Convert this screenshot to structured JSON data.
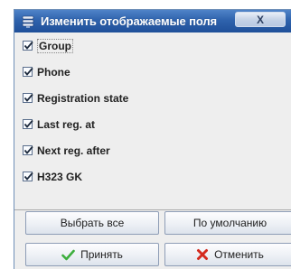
{
  "dialog": {
    "title": "Изменить отображаемые поля",
    "close_glyph": "X"
  },
  "fields": [
    {
      "label": "Group",
      "checked": true
    },
    {
      "label": "Phone",
      "checked": true
    },
    {
      "label": "Registration state",
      "checked": true
    },
    {
      "label": "Last reg. at",
      "checked": true
    },
    {
      "label": "Next reg. after",
      "checked": true
    },
    {
      "label": "H323 GK",
      "checked": true
    }
  ],
  "buttons": {
    "select_all": "Выбрать все",
    "defaults": "По умолчанию",
    "accept": "Принять",
    "cancel": "Отменить"
  },
  "icons": {
    "app": "app-icon",
    "accept": "check-icon",
    "cancel": "cross-icon"
  },
  "colors": {
    "title_bar": "#2f63ad",
    "accept_icon": "#3cae3c",
    "cancel_icon": "#d42a1e"
  }
}
